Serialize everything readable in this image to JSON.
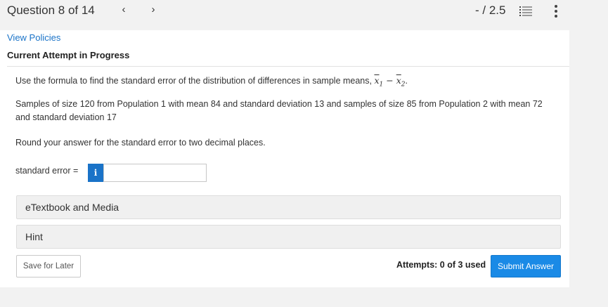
{
  "header": {
    "question_title": "Question 8 of 14",
    "prev_icon": "‹",
    "next_icon": "›",
    "score": "- / 2.5",
    "icons": [
      "list-icon",
      "more-vertical-icon",
      "chevron-left-icon",
      "chevron-right-icon"
    ]
  },
  "links": {
    "view_policies": "View Policies"
  },
  "status": {
    "attempt_label": "Current Attempt in Progress"
  },
  "question": {
    "line1_text": "Use the formula to find the standard error of the distribution of differences in sample means, ",
    "formula_x": "x",
    "sub1": "1",
    "minus": " − ",
    "sub2": "2",
    "period": ".",
    "line2": "Samples of size 120 from Population 1 with mean 84 and standard deviation 13 and samples of size 85 from Population 2 with mean 72 and standard deviation 17",
    "line3": "Round your answer for the standard error to two decimal places."
  },
  "answer": {
    "label": "standard error =",
    "info_glyph": "i",
    "value": ""
  },
  "panels": {
    "etextbook": "eTextbook and Media",
    "hint": "Hint"
  },
  "footer": {
    "save_label": "Save for Later",
    "attempts_text": "Attempts: 0 of 3 used",
    "submit_label": "Submit Answer"
  },
  "colors": {
    "accent": "#1a73c8",
    "submit": "#1a8ae6",
    "background": "#f2f2f2"
  }
}
